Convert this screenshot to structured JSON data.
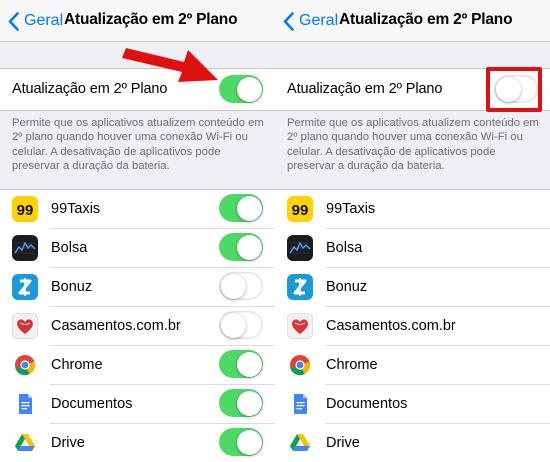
{
  "colors": {
    "accent": "#007aff",
    "switch_on": "#4cd964",
    "annotation": "#e01010"
  },
  "left": {
    "nav": {
      "back_label": "Geral",
      "title": "Atualização em 2º Plano"
    },
    "master": {
      "label": "Atualização em 2º Plano",
      "state": "on"
    },
    "footer": "Permite que os aplicativos atualizem conteúdo em 2º plano quando houver uma conexão Wi-Fi ou celular. A desativação de aplicativos pode preservar a duração da bateria.",
    "apps": [
      {
        "name": "99Taxis",
        "icon": "99taxis-icon",
        "state": "on"
      },
      {
        "name": "Bolsa",
        "icon": "stocks-icon",
        "state": "on"
      },
      {
        "name": "Bonuz",
        "icon": "bonuz-icon",
        "state": "off"
      },
      {
        "name": "Casamentos.com.br",
        "icon": "casamentos-icon",
        "state": "off"
      },
      {
        "name": "Chrome",
        "icon": "chrome-icon",
        "state": "on"
      },
      {
        "name": "Documentos",
        "icon": "docs-icon",
        "state": "on"
      },
      {
        "name": "Drive",
        "icon": "drive-icon",
        "state": "on"
      }
    ]
  },
  "right": {
    "nav": {
      "back_label": "Geral",
      "title": "Atualização em 2º Plano"
    },
    "master": {
      "label": "Atualização em 2º Plano",
      "state": "off"
    },
    "footer": "Permite que os aplicativos atualizem conteúdo em 2º plano quando houver uma conexão Wi-Fi ou celular. A desativação de aplicativos pode preservar a duração da bateria.",
    "apps": [
      {
        "name": "99Taxis",
        "icon": "99taxis-icon"
      },
      {
        "name": "Bolsa",
        "icon": "stocks-icon"
      },
      {
        "name": "Bonuz",
        "icon": "bonuz-icon"
      },
      {
        "name": "Casamentos.com.br",
        "icon": "casamentos-icon"
      },
      {
        "name": "Chrome",
        "icon": "chrome-icon"
      },
      {
        "name": "Documentos",
        "icon": "docs-icon"
      },
      {
        "name": "Drive",
        "icon": "drive-icon"
      }
    ]
  }
}
